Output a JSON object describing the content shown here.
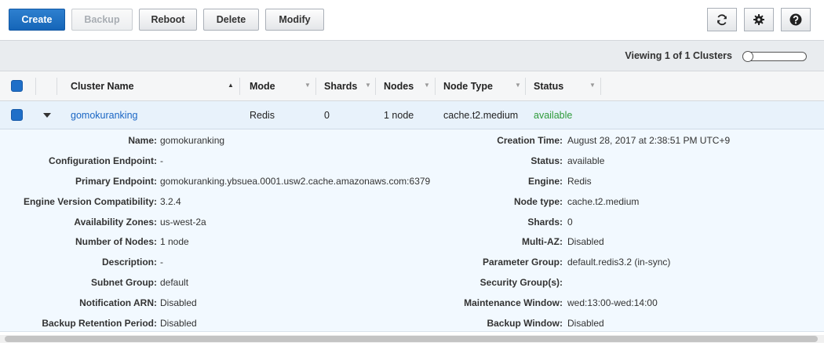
{
  "toolbar": {
    "create_label": "Create",
    "backup_label": "Backup",
    "reboot_label": "Reboot",
    "delete_label": "Delete",
    "modify_label": "Modify",
    "icons": [
      "refresh-icon",
      "gear-icon",
      "help-icon"
    ]
  },
  "pager": {
    "viewing_text": "Viewing 1 of 1 Clusters"
  },
  "table": {
    "columns": [
      "Cluster Name",
      "Mode",
      "Shards",
      "Nodes",
      "Node Type",
      "Status"
    ],
    "sorted_column": "Cluster Name",
    "rows": [
      {
        "cluster_name": "gomokuranking",
        "mode": "Redis",
        "shards": "0",
        "nodes": "1 node",
        "node_type": "cache.t2.medium",
        "status": "available"
      }
    ]
  },
  "details": {
    "left": [
      {
        "label": "Name:",
        "value": "gomokuranking"
      },
      {
        "label": "Configuration Endpoint:",
        "value": "-"
      },
      {
        "label": "Primary Endpoint:",
        "value": "gomokuranking.ybsuea.0001.usw2.cache.amazonaws.com:6379"
      },
      {
        "label": "Engine Version Compatibility:",
        "value": "3.2.4"
      },
      {
        "label": "Availability Zones:",
        "value": "us-west-2a"
      },
      {
        "label": "Number of Nodes:",
        "value": "1 node"
      },
      {
        "label": "Description:",
        "value": "-"
      },
      {
        "label": "Subnet Group:",
        "value": "default"
      },
      {
        "label": "Notification ARN:",
        "value": "Disabled"
      },
      {
        "label": "Backup Retention Period:",
        "value": "Disabled"
      }
    ],
    "right": [
      {
        "label": "Creation Time:",
        "value": "August 28, 2017 at 2:38:51 PM UTC+9"
      },
      {
        "label": "Status:",
        "value": "available"
      },
      {
        "label": "Engine:",
        "value": "Redis"
      },
      {
        "label": "Node type:",
        "value": "cache.t2.medium"
      },
      {
        "label": "Shards:",
        "value": "0"
      },
      {
        "label": "Multi-AZ:",
        "value": "Disabled"
      },
      {
        "label": "Parameter Group:",
        "value": "default.redis3.2 (in-sync)"
      },
      {
        "label": "Security Group(s):",
        "value": ""
      },
      {
        "label": "Maintenance Window:",
        "value": "wed:13:00-wed:14:00"
      },
      {
        "label": "Backup Window:",
        "value": "Disabled"
      }
    ]
  },
  "colors": {
    "primary_button": "#1f6fc8",
    "link": "#1a66c4",
    "status_available": "#2e9b3a",
    "selected_row": "#e8f2fb"
  }
}
